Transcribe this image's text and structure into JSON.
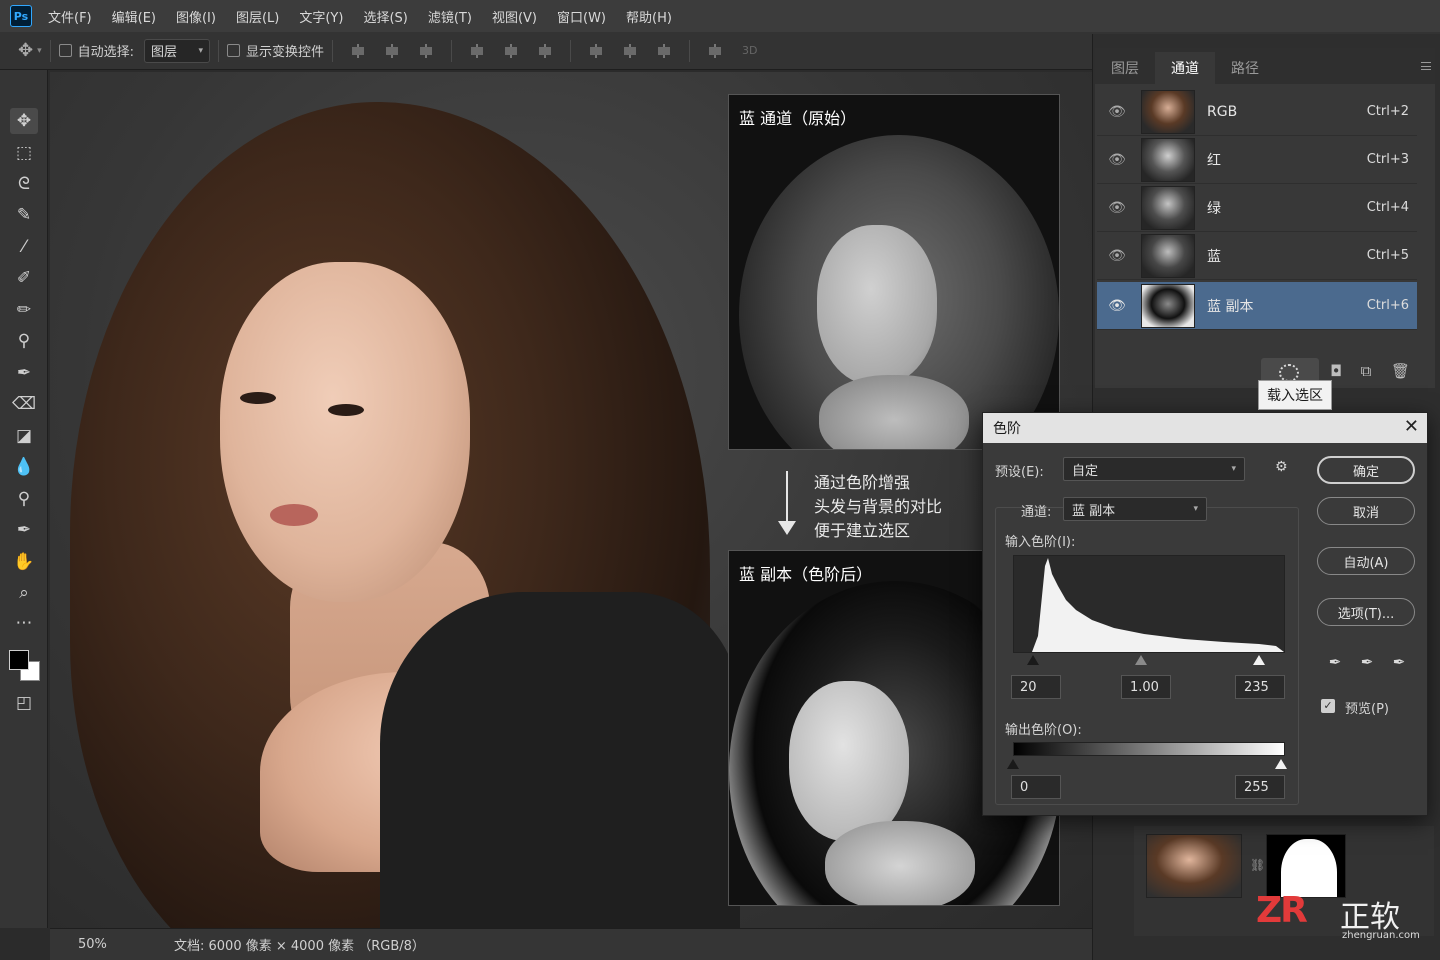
{
  "app": {
    "logo_text": "Ps"
  },
  "menu": [
    "文件(F)",
    "编辑(E)",
    "图像(I)",
    "图层(L)",
    "文字(Y)",
    "选择(S)",
    "滤镜(T)",
    "视图(V)",
    "窗口(W)",
    "帮助(H)"
  ],
  "options_bar": {
    "auto_select_label": "自动选择:",
    "auto_select_value": "图层",
    "show_transform_label": "显示变换控件",
    "mode_3d": "3D"
  },
  "tools": [
    "move-tool-icon",
    "marquee-tool-icon",
    "lasso-tool-icon",
    "quick-select-icon",
    "brush-tool-icon",
    "healing-brush-icon",
    "pencil-icon",
    "clone-stamp-icon",
    "history-brush-icon",
    "eraser-icon",
    "gradient-icon",
    "blur-icon",
    "dodge-icon",
    "pen-tool-icon",
    "hand-tool-icon",
    "zoom-tool-icon",
    "more-tools-icon"
  ],
  "comparison": {
    "original_title": "蓝 通道（原始）",
    "after_title": "蓝 副本（色阶后）",
    "note_lines": [
      "通过色阶增强",
      "头发与背景的对比",
      "便于建立选区"
    ]
  },
  "statusbar": {
    "zoom": "50%",
    "doc_info": "文档: 6000 像素 × 4000 像素 （RGB/8）"
  },
  "channels_panel": {
    "tabs": [
      "图层",
      "通道",
      "路径"
    ],
    "active_tab": 1,
    "rows": [
      {
        "name": "RGB",
        "shortcut": "Ctrl+2"
      },
      {
        "name": "红",
        "shortcut": "Ctrl+3"
      },
      {
        "name": "绿",
        "shortcut": "Ctrl+4"
      },
      {
        "name": "蓝",
        "shortcut": "Ctrl+5"
      },
      {
        "name": "蓝 副本",
        "shortcut": "Ctrl+6"
      }
    ],
    "selected_row": 4,
    "tooltip": "载入选区"
  },
  "levels_dialog": {
    "title": "色阶",
    "preset_label": "预设(E):",
    "preset_value": "自定",
    "channel_label": "通道:",
    "channel_value": "蓝 副本",
    "input_label": "输入色阶(I):",
    "input_black": "20",
    "input_gamma": "1.00",
    "input_white": "235",
    "output_label": "输出色阶(O):",
    "output_black": "0",
    "output_white": "255",
    "buttons": {
      "ok": "确定",
      "cancel": "取消",
      "auto": "自动(A)",
      "options": "选项(T)..."
    },
    "preview_label": "预览(P)",
    "preview_checked": true
  },
  "watermark": {
    "logo": "ZR",
    "brand": "正软",
    "url": "zhengruan.com"
  },
  "colors": {
    "accent_selected": "#4b6a8e",
    "ps_blue": "#31a8ff",
    "watermark_red": "#e23a3a"
  }
}
